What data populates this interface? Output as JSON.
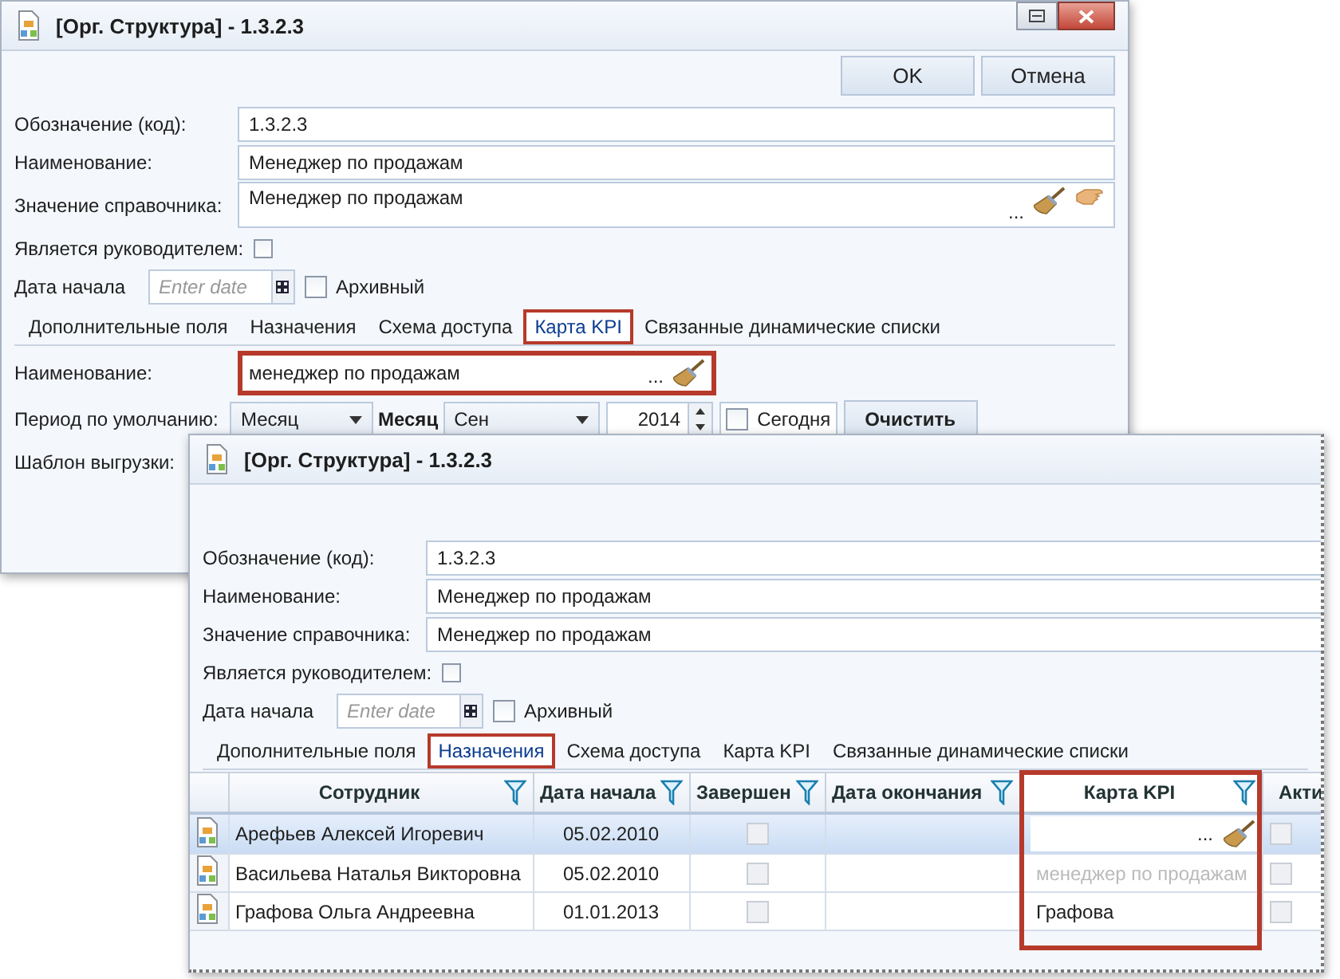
{
  "back_window": {
    "title": "[Орг. Структура] - 1.3.2.3",
    "buttons": [
      "OK",
      "Отмена"
    ],
    "fields": [
      {
        "label": "Обозначение (код):",
        "value": "1.3.2.3",
        "kind": "text"
      },
      {
        "label": "Наименование:",
        "value": "Менеджер по продажам",
        "kind": "text"
      },
      {
        "label": "Значение справочника:",
        "value": "Менеджер по продажам",
        "kind": "lookup",
        "ellipsis": "..."
      }
    ],
    "is_manager": {
      "label": "Является руководителем:",
      "checked": false
    },
    "start_date": {
      "label": "Дата начала",
      "placeholder": "Enter date"
    },
    "archived": {
      "label": "Архивный",
      "checked": false
    },
    "tabs": [
      {
        "label": "Дополнительные поля",
        "selected": false,
        "highlighted": false
      },
      {
        "label": "Назначения",
        "selected": false,
        "highlighted": false
      },
      {
        "label": "Схема доступа",
        "selected": false,
        "highlighted": false
      },
      {
        "label": "Карта KPI",
        "selected": true,
        "highlighted": true
      },
      {
        "label": "Связанные динамические списки",
        "selected": false,
        "highlighted": false
      }
    ],
    "kpi": {
      "name_label": "Наименование:",
      "name_value": "менеджер по продажам",
      "name_ellipsis": "...",
      "name_highlighted": true,
      "period_label": "Период по умолчанию:",
      "period_value": "Месяц",
      "month_label": "Месяц",
      "month_value": "Сен",
      "year": "2014",
      "today_label": "Сегодня",
      "today_checked": false,
      "clear_button": "Очистить",
      "template_label": "Шаблон выгрузки:"
    }
  },
  "front_window": {
    "title": "[Орг. Структура] - 1.3.2.3",
    "fields": [
      {
        "label": "Обозначение (код):",
        "value": "1.3.2.3"
      },
      {
        "label": "Наименование:",
        "value": "Менеджер по продажам"
      },
      {
        "label": "Значение справочника:",
        "value": "Менеджер по продажам"
      }
    ],
    "is_manager": {
      "label": "Является руководителем:",
      "checked": false
    },
    "start_date": {
      "label": "Дата начала",
      "placeholder": "Enter date"
    },
    "archived": {
      "label": "Архивный",
      "checked": false
    },
    "tabs": [
      {
        "label": "Дополнительные поля",
        "selected": false,
        "highlighted": false
      },
      {
        "label": "Назначения",
        "selected": true,
        "highlighted": true
      },
      {
        "label": "Схема доступа",
        "selected": false,
        "highlighted": false
      },
      {
        "label": "Карта KPI",
        "selected": false,
        "highlighted": false
      },
      {
        "label": "Связанные динамические списки",
        "selected": false,
        "highlighted": false
      }
    ],
    "grid": {
      "columns": [
        {
          "label": "Сотрудник",
          "highlighted": false
        },
        {
          "label": "Дата начала",
          "highlighted": false
        },
        {
          "label": "Завершен",
          "highlighted": false
        },
        {
          "label": "Дата окончания",
          "highlighted": false
        },
        {
          "label": "Карта KPI",
          "highlighted": true
        },
        {
          "label": "Акти",
          "highlighted": false
        }
      ],
      "rows": [
        {
          "employee": "Арефьев Алексей Игоревич",
          "start_date": "05.02.2010",
          "done": false,
          "kpi": "...",
          "kind": "editor",
          "selected": true
        },
        {
          "employee": "Васильева Наталья Викторовна",
          "start_date": "05.02.2010",
          "done": false,
          "kpi": "менеджер по продажам",
          "kind": "hint",
          "selected": false
        },
        {
          "employee": "Графова Ольга Андреевна",
          "start_date": "01.01.2013",
          "done": false,
          "kpi": "Графова",
          "kind": "value",
          "selected": false
        }
      ]
    }
  }
}
